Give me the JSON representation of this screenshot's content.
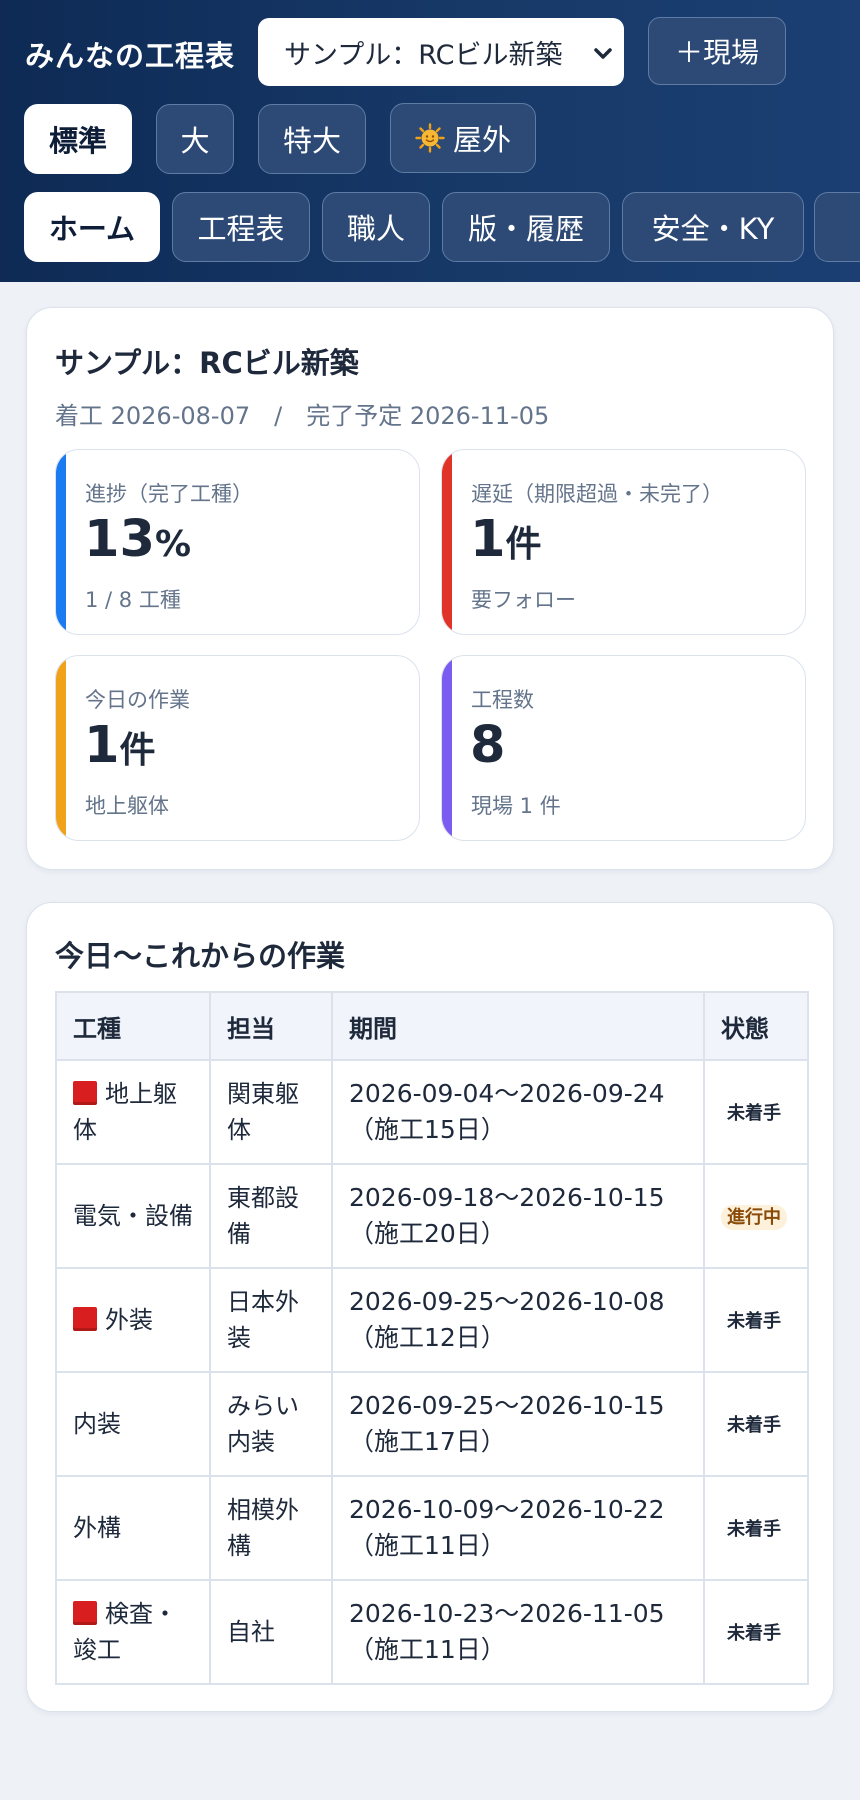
{
  "header": {
    "app_title": "みんなの工程表",
    "site_select": {
      "value": "サンプル：RCビル新築"
    },
    "add_site_label": "＋現場",
    "view_modes": [
      {
        "label": "標準",
        "active": true
      },
      {
        "label": "大",
        "active": false
      },
      {
        "label": "特大",
        "active": false
      },
      {
        "label": "屋外",
        "active": false,
        "icon": "sun-icon"
      }
    ],
    "tabs": [
      {
        "label": "ホーム",
        "active": true
      },
      {
        "label": "工程表",
        "active": false
      },
      {
        "label": "職人",
        "active": false
      },
      {
        "label": "版・履歴",
        "active": false
      },
      {
        "label": "安全・KY",
        "active": false
      }
    ]
  },
  "summary": {
    "title": "サンプル：RCビル新築",
    "start": "着工 2026-08-07",
    "separator": "/",
    "end": "完了予定 2026-11-05",
    "stats": [
      {
        "label": "進捗（完了工種）",
        "value": "13",
        "unit": "%",
        "sub": "1 / 8 工種",
        "color": "#1a7cf0"
      },
      {
        "label": "遅延（期限超過・未完了）",
        "value": "1",
        "unit": "件",
        "sub": "要フォロー",
        "color": "#e03428"
      },
      {
        "label": "今日の作業",
        "value": "1",
        "unit": "件",
        "sub": "地上躯体",
        "color": "#f1a21b"
      },
      {
        "label": "工程数",
        "value": "8",
        "unit": "",
        "sub": "現場 1 件",
        "color": "#7b5cf0"
      }
    ]
  },
  "upcoming": {
    "title": "今日〜これからの作業",
    "columns": [
      "工種",
      "担当",
      "期間",
      "状態"
    ],
    "rows": [
      {
        "trade": "地上躯体",
        "flag": true,
        "person": "関東躯体",
        "period": "2026-09-04〜2026-09-24",
        "days": "（施工15日）",
        "status": "未着手",
        "status_kind": "not-started"
      },
      {
        "trade": "電気・設備",
        "flag": false,
        "person": "東都設備",
        "period": "2026-09-18〜2026-10-15",
        "days": "（施工20日）",
        "status": "進行中",
        "status_kind": "in-progress"
      },
      {
        "trade": "外装",
        "flag": true,
        "person": "日本外装",
        "period": "2026-09-25〜2026-10-08",
        "days": "（施工12日）",
        "status": "未着手",
        "status_kind": "not-started"
      },
      {
        "trade": "内装",
        "flag": false,
        "person": "みらい内装",
        "period": "2026-09-25〜2026-10-15",
        "days": "（施工17日）",
        "status": "未着手",
        "status_kind": "not-started"
      },
      {
        "trade": "外構",
        "flag": false,
        "person": "相模外構",
        "period": "2026-10-09〜2026-10-22",
        "days": "（施工11日）",
        "status": "未着手",
        "status_kind": "not-started"
      },
      {
        "trade": "検査・竣工",
        "flag": true,
        "person": "自社",
        "period": "2026-10-23〜2026-11-05",
        "days": "（施工11日）",
        "status": "未着手",
        "status_kind": "not-started"
      }
    ]
  }
}
